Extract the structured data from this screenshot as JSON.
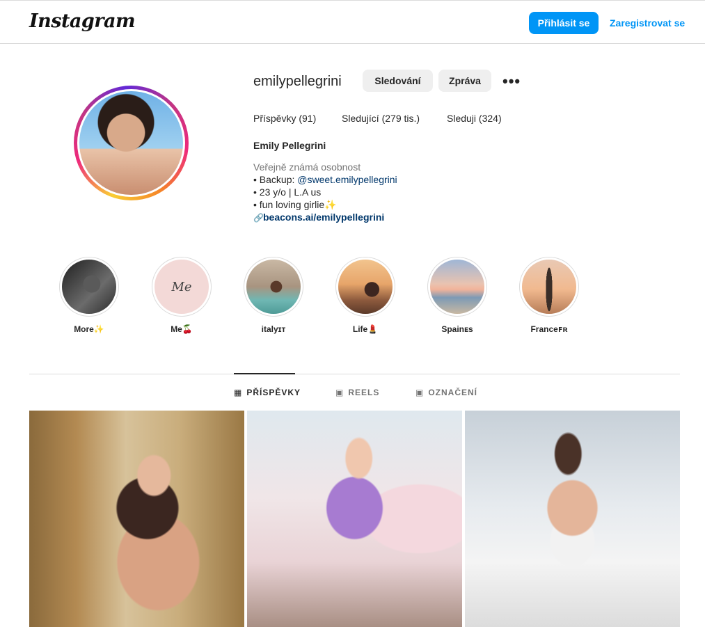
{
  "header": {
    "logo_text": "Instagram",
    "login_label": "Přihlásit se",
    "register_label": "Zaregistrovat se"
  },
  "profile": {
    "username": "emilypellegrini",
    "follow_label": "Sledování",
    "message_label": "Zpráva",
    "more_label": "•••",
    "posts_stat": "Příspěvky (91)",
    "followers_stat": "Sledující (279 tis.)",
    "following_stat": "Sleduji (324)",
    "full_name": "Emily Pellegrini",
    "category": "Veřejně známá osobnost",
    "bio_line1_prefix": "• Backup: ",
    "bio_line1_mention": "@sweet.emilypellegrini",
    "bio_line2": "• 23 y/o | L.A us",
    "bio_line3": "• fun loving girlie✨",
    "link_text": "beacons.ai/emilypellegrini"
  },
  "highlights": [
    {
      "label": "More✨"
    },
    {
      "label": "Me🍒",
      "cover_text": "Me"
    },
    {
      "label": "italyɪᴛ"
    },
    {
      "label": "Life💄"
    },
    {
      "label": "Spainᴇs"
    },
    {
      "label": "Franceꜰʀ"
    }
  ],
  "tabs": {
    "posts": "PŘÍSPĚVKY",
    "reels": "REELS",
    "tagged": "OZNAČENÍ"
  },
  "colors": {
    "accent": "#0095f6",
    "link": "#00376b",
    "muted": "#737373",
    "border": "#dbdbdb"
  }
}
